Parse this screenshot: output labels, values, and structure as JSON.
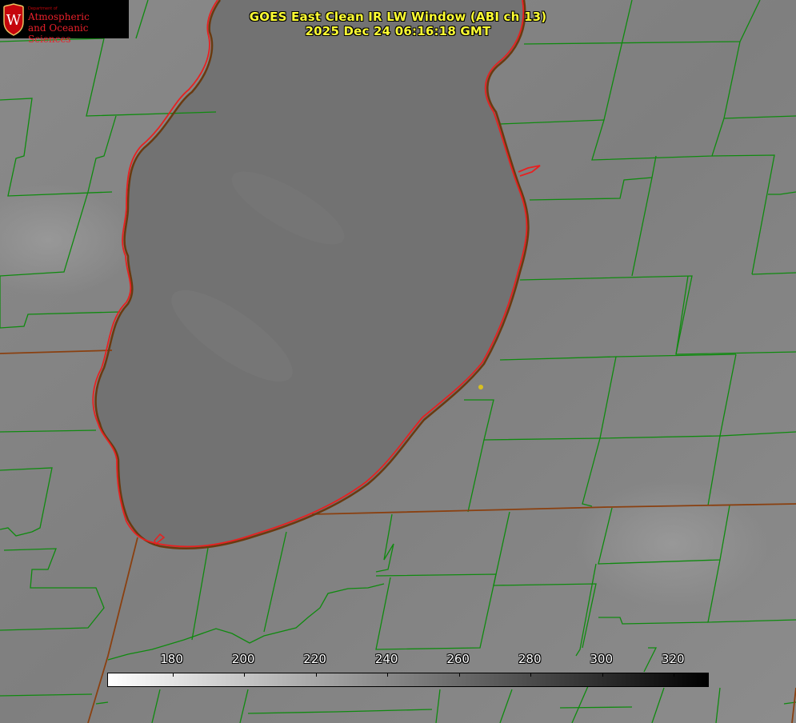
{
  "title": {
    "line1": "GOES East Clean IR LW Window (ABI ch 13)",
    "line2": "2025 Dec 24 06:16:18 GMT"
  },
  "logo": {
    "department": "Department of",
    "name_line1": "Atmospheric",
    "name_line2": "and Oceanic Sciences",
    "seal_letter": "W"
  },
  "colorbar": {
    "tick_labels": [
      "180",
      "200",
      "220",
      "240",
      "260",
      "280",
      "300",
      "320"
    ],
    "range_min": 162,
    "range_max": 330,
    "gradient": "white-to-black",
    "units": ""
  },
  "map": {
    "background_gray": "#7e7e7e",
    "lake_gray": "#707070",
    "county_line_color": "#0f8a0f",
    "state_line_color": "#8a4010",
    "shoreline_color": "#e82020",
    "station_marker_color": "#d8c020"
  }
}
